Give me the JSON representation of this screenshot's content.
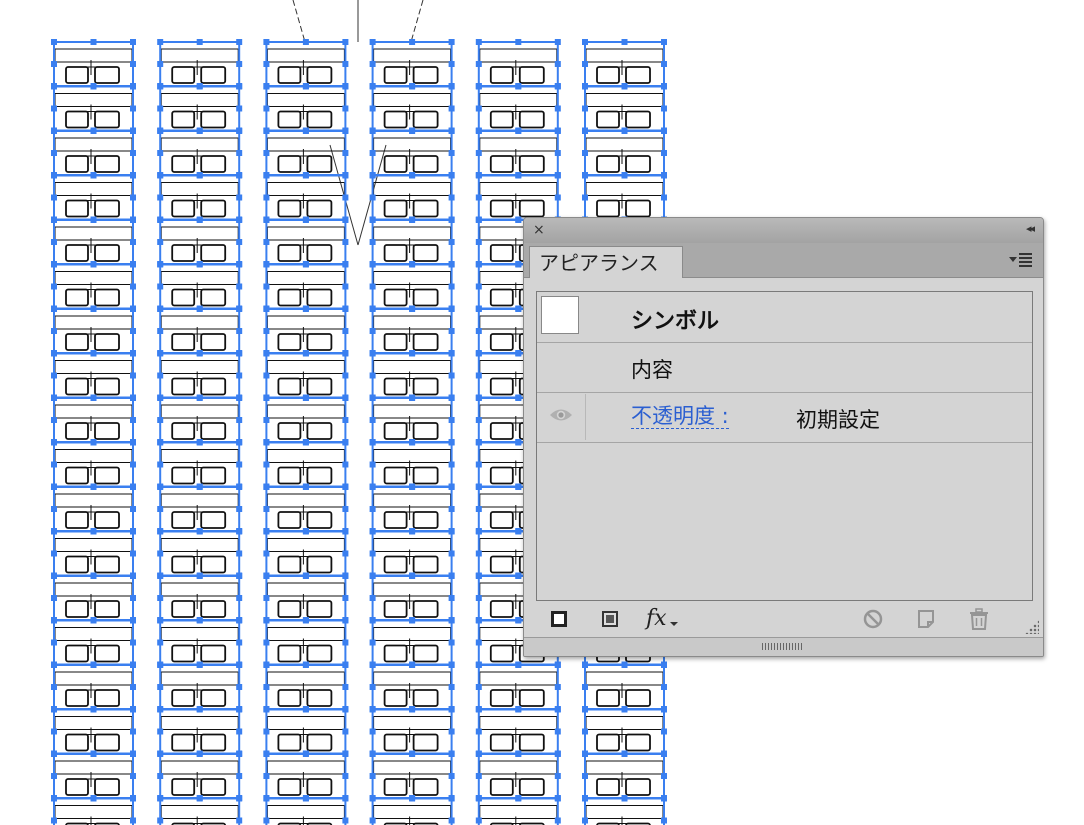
{
  "canvas": {
    "selection_color": "#3a7ff0",
    "object": "symbol-instance",
    "columns": 6,
    "rows": 18
  },
  "panel": {
    "tab_label": "アピアランス",
    "close_glyph": "×",
    "collapse_glyph": "◂◂",
    "menu_icon": "panel-menu-icon",
    "rows": {
      "object_title": "シンボル",
      "contents_label": "内容",
      "opacity_label": "不透明度 :",
      "opacity_value": "初期設定"
    },
    "link_color": "#2b5fd1",
    "toolbar_icons": [
      "add-new-stroke-icon",
      "add-new-fill-icon",
      "add-new-effect-icon",
      "clear-appearance-icon",
      "duplicate-item-icon",
      "delete-item-icon"
    ],
    "fx_label": "fx"
  }
}
